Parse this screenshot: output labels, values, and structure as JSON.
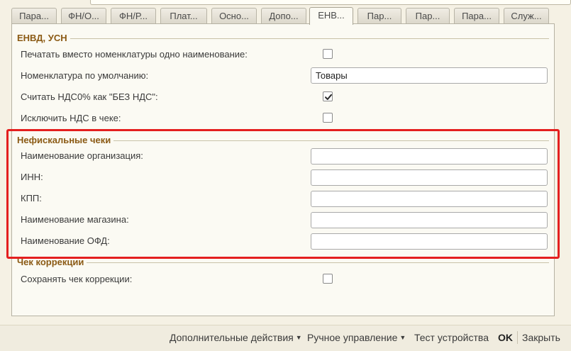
{
  "tabs": [
    "Пара...",
    "ФН/О...",
    "ФН/Р...",
    "Плат...",
    "Осно...",
    "Допо...",
    "ЕНВ...",
    "Пар...",
    "Пар...",
    "Пара...",
    "Служ..."
  ],
  "active_tab_index": 6,
  "groups": {
    "envd": {
      "title": "ЕНВД, УСН",
      "print_instead_label": "Печатать вместо номенклатуры одно наименование:",
      "print_instead_checked": false,
      "default_nomenclature_label": "Номенклатура по умолчанию:",
      "default_nomenclature_value": "Товары",
      "vat0_label": "Считать НДС0% как \"БЕЗ НДС\":",
      "vat0_checked": true,
      "exclude_vat_label": "Исключить НДС в чеке:",
      "exclude_vat_checked": false
    },
    "nonfiscal": {
      "title": "Нефискальные чеки",
      "org_name_label": "Наименование организация:",
      "org_name_value": "",
      "inn_label": "ИНН:",
      "inn_value": "",
      "kpp_label": "КПП:",
      "kpp_value": "",
      "store_name_label": "Наименование магазина:",
      "store_name_value": "",
      "ofd_name_label": "Наименование ОФД:",
      "ofd_name_value": ""
    },
    "correction": {
      "title": "Чек коррекции",
      "save_label": "Сохранять чек коррекции:",
      "save_checked": false
    }
  },
  "commands": {
    "more_actions": "Дополнительные действия",
    "manual_control": "Ручное управление",
    "test_device": "Тест устройства",
    "ok": "OK",
    "close": "Закрыть"
  },
  "colors": {
    "highlight": "#e41f1f",
    "group_title": "#8b5a14",
    "background": "#f5f1e4"
  },
  "icons": {
    "checkmark": "check-icon",
    "dropdown": "triangle-down-icon"
  }
}
